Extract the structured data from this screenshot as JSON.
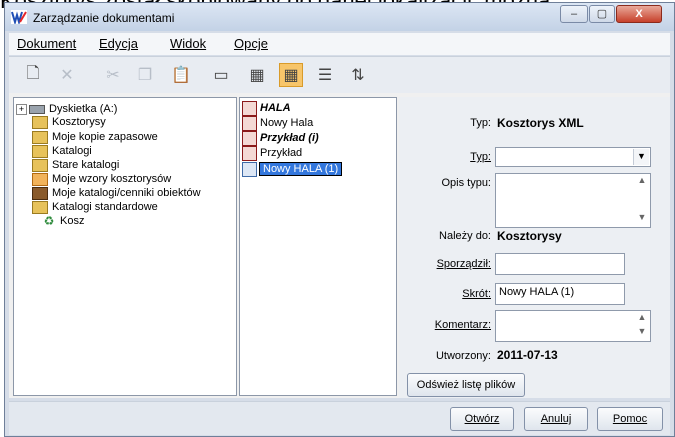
{
  "background_text": "Kosztorys został skopiowany do danej lokalizacji, można",
  "window": {
    "title": "Zarządzanie dokumentami",
    "controls": {
      "minimize": "‒",
      "maximize": "▢",
      "close": "X"
    }
  },
  "menu": [
    "Dokument",
    "Edycja",
    "Widok",
    "Opcje"
  ],
  "toolbar": {
    "buttons": [
      {
        "icon": "new-document-icon",
        "glyph": "🗋"
      },
      {
        "icon": "delete-icon",
        "glyph": "✕"
      },
      {
        "icon": "cut-icon",
        "glyph": "✂"
      },
      {
        "icon": "copy-icon",
        "glyph": "❐"
      },
      {
        "icon": "paste-icon",
        "glyph": "📋"
      },
      {
        "icon": "preview-icon",
        "glyph": "▭"
      },
      {
        "icon": "large-icons-view-icon",
        "glyph": "▦"
      },
      {
        "icon": "small-icons-view-icon",
        "glyph": "▦"
      },
      {
        "icon": "list-view-icon",
        "glyph": "☰"
      },
      {
        "icon": "details-view-icon",
        "glyph": "⇅"
      }
    ]
  },
  "tree": {
    "items": [
      {
        "label": "Dyskietka (A:)",
        "icon": "floppy-drive-icon"
      },
      {
        "label": "Kosztorysy",
        "icon": "folder-icon"
      },
      {
        "label": "Moje kopie zapasowe",
        "icon": "folder-icon"
      },
      {
        "label": "Katalogi",
        "icon": "folder-icon"
      },
      {
        "label": "Stare katalogi",
        "icon": "folder-icon"
      },
      {
        "label": "Moje wzory kosztorysów",
        "icon": "template-folder-icon"
      },
      {
        "label": "Moje katalogi/cenniki obiektów",
        "icon": "catalog-folder-icon"
      },
      {
        "label": "Katalogi standardowe",
        "icon": "folder-icon"
      },
      {
        "label": "Kosz",
        "icon": "recycle-bin-icon"
      }
    ]
  },
  "files": {
    "items": [
      {
        "label": "HALA",
        "style": "bold-italic"
      },
      {
        "label": "Nowy Hala",
        "style": "normal"
      },
      {
        "label": "Przykład (i)",
        "style": "bold-italic"
      },
      {
        "label": "Przykład",
        "style": "normal"
      },
      {
        "label": "Nowy HALA (1)",
        "style": "selected"
      }
    ]
  },
  "properties": {
    "type_label": "Typ:",
    "type_value": "Kosztorys XML",
    "type_select_label": "Typ:",
    "type_select_value": "",
    "type_desc_label": "Opis typu:",
    "type_desc_value": "",
    "belongs_label": "Należy do:",
    "belongs_value": "Kosztorysy",
    "prepared_label": "Sporządził:",
    "prepared_value": "",
    "short_label": "Skrót:",
    "short_value": "Nowy HALA (1)",
    "comment_label": "Komentarz:",
    "comment_value": "",
    "created_label": "Utworzony:",
    "created_value": "2011-07-13",
    "refresh_button": "Odśwież listę plików"
  },
  "buttons": {
    "open": "Otwórz",
    "cancel": "Anuluj",
    "help": "Pomoc"
  }
}
